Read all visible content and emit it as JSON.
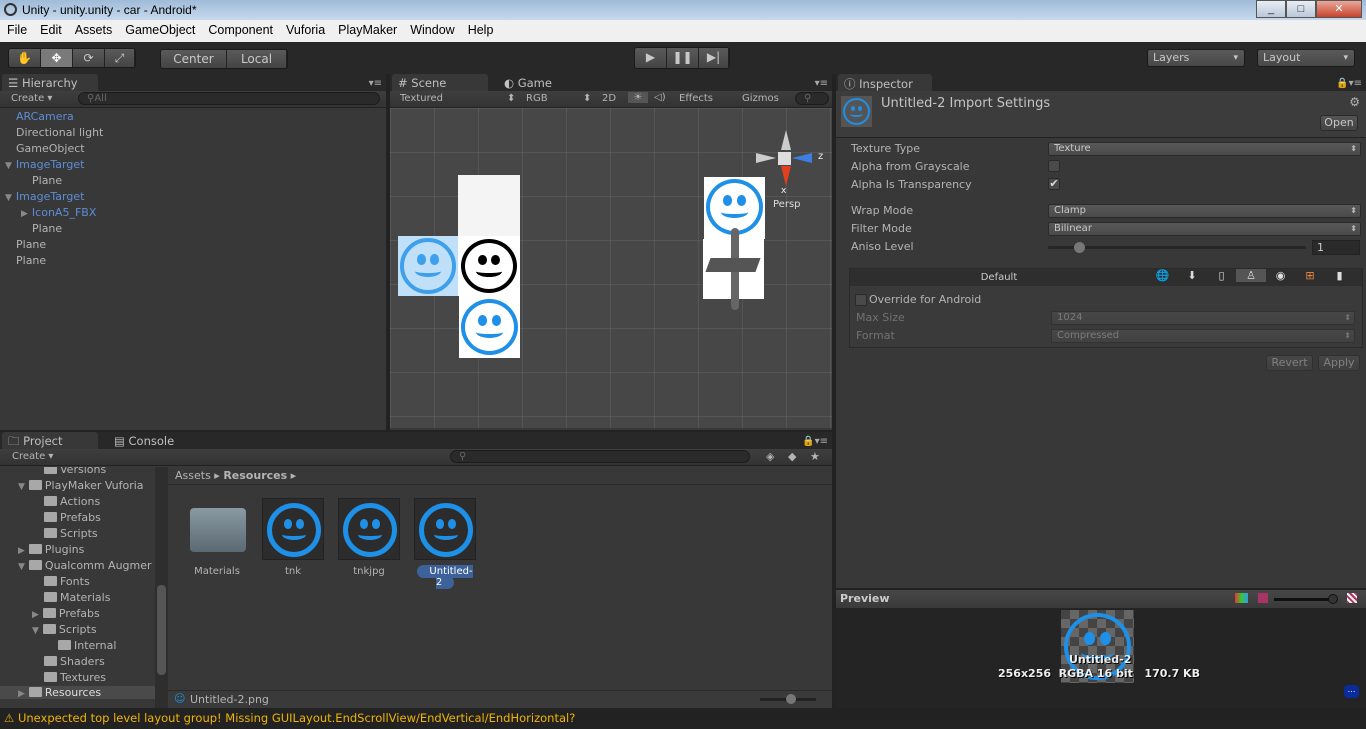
{
  "window": {
    "title": "Unity - unity.unity - car - Android*",
    "controls": [
      "minimize",
      "maximize",
      "close"
    ]
  },
  "menu": [
    "File",
    "Edit",
    "Assets",
    "GameObject",
    "Component",
    "Vuforia",
    "PlayMaker",
    "Window",
    "Help"
  ],
  "toolbar": {
    "tools": [
      "hand-icon",
      "move-icon",
      "rotate-icon",
      "scale-icon"
    ],
    "pivot": "Center",
    "space": "Local",
    "layers": "Layers",
    "layout": "Layout"
  },
  "hierarchy": {
    "tab": "Hierarchy",
    "create": "Create",
    "search_placeholder": "All",
    "items": [
      {
        "label": "ARCamera",
        "blue": true
      },
      {
        "label": "Directional light"
      },
      {
        "label": "GameObject"
      },
      {
        "label": "ImageTarget",
        "blue": true,
        "expanded": true
      },
      {
        "label": "Plane",
        "indent": 1
      },
      {
        "label": "ImageTarget",
        "blue": true,
        "expanded": true
      },
      {
        "label": "IconA5_FBX",
        "blue": true,
        "indent": 1,
        "collapsed": true
      },
      {
        "label": "Plane",
        "indent": 1
      },
      {
        "label": "Plane"
      },
      {
        "label": "Plane"
      }
    ]
  },
  "scene": {
    "tabs": [
      "Scene",
      "Game"
    ],
    "render_mode": "Textured",
    "channel": "RGB",
    "mode_2d": "2D",
    "effects": "Effects",
    "gizmos": "Gizmos",
    "persp": "Persp",
    "axis_z": "z",
    "axis_x": "x"
  },
  "inspector": {
    "tab": "Inspector",
    "title": "Untitled-2 Import Settings",
    "open": "Open",
    "fields": {
      "texture_type": {
        "label": "Texture Type",
        "value": "Texture"
      },
      "alpha_gray": {
        "label": "Alpha from Grayscale",
        "checked": false
      },
      "alpha_transp": {
        "label": "Alpha Is Transparency",
        "checked": true
      },
      "wrap": {
        "label": "Wrap Mode",
        "value": "Clamp"
      },
      "filter": {
        "label": "Filter Mode",
        "value": "Bilinear"
      },
      "aniso": {
        "label": "Aniso Level",
        "value": "1"
      }
    },
    "platform": {
      "default": "Default",
      "icons": [
        "web-icon",
        "standalone-icon",
        "ios-icon",
        "android-icon",
        "blackberry-icon",
        "windows-icon",
        "windows-phone-icon"
      ],
      "selected": "android-icon",
      "override": "Override for Android",
      "max_size": {
        "label": "Max Size",
        "value": "1024"
      },
      "format": {
        "label": "Format",
        "value": "Compressed"
      }
    },
    "revert": "Revert",
    "apply": "Apply"
  },
  "preview": {
    "title": "Preview",
    "name": "Untitled-2",
    "info": "256x256  RGBA 16 bit   170.7 KB"
  },
  "project": {
    "tabs": [
      "Project",
      "Console"
    ],
    "create": "Create",
    "tree": [
      {
        "label": "Versions",
        "indent": 2
      },
      {
        "label": "PlayMaker Vuforia",
        "indent": 1,
        "expanded": true
      },
      {
        "label": "Actions",
        "indent": 2
      },
      {
        "label": "Prefabs",
        "indent": 2
      },
      {
        "label": "Scripts",
        "indent": 2
      },
      {
        "label": "Plugins",
        "indent": 1,
        "collapsed": true
      },
      {
        "label": "Qualcomm Augmer",
        "indent": 1,
        "expanded": true
      },
      {
        "label": "Fonts",
        "indent": 2
      },
      {
        "label": "Materials",
        "indent": 2
      },
      {
        "label": "Prefabs",
        "indent": 2,
        "collapsed": true
      },
      {
        "label": "Scripts",
        "indent": 2,
        "expanded": true
      },
      {
        "label": "Internal",
        "indent": 3
      },
      {
        "label": "Shaders",
        "indent": 2
      },
      {
        "label": "Textures",
        "indent": 2
      },
      {
        "label": "Resources",
        "indent": 1,
        "collapsed": true,
        "selected": true
      }
    ],
    "breadcrumb": [
      "Assets",
      "Resources"
    ],
    "assets": [
      {
        "label": "Materials",
        "kind": "folder"
      },
      {
        "label": "tnk",
        "kind": "texture"
      },
      {
        "label": "tnkjpg",
        "kind": "texture"
      },
      {
        "label": "Untitled-2",
        "kind": "texture",
        "selected": true
      }
    ],
    "selected_file": "Untitled-2.png"
  },
  "status": {
    "message": "Unexpected top level layout group! Missing GUILayout.EndScrollView/EndVertical/EndHorizontal?",
    "color": "#f0b400"
  }
}
